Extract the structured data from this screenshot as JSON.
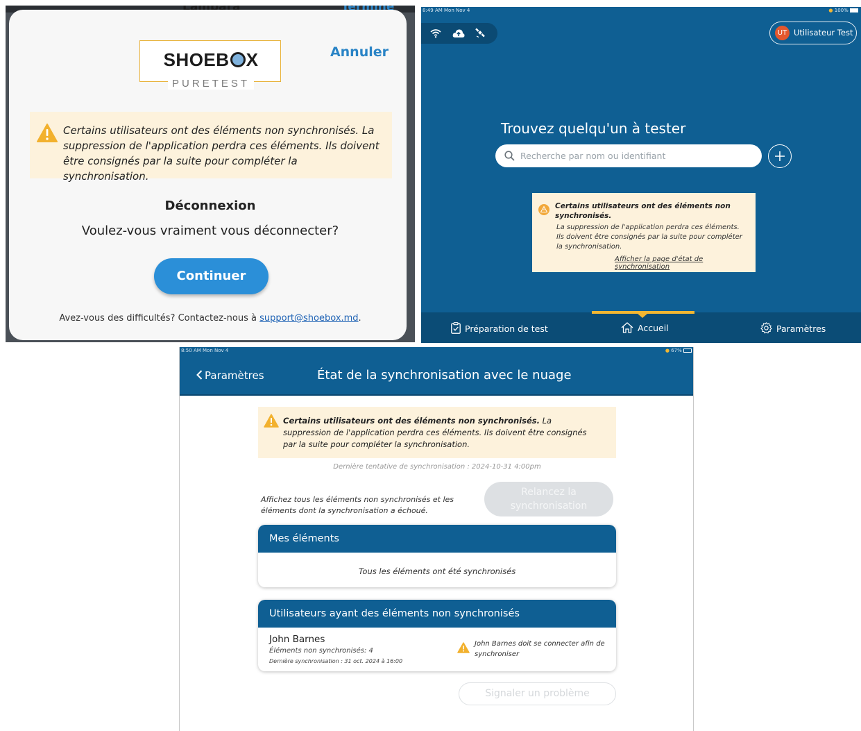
{
  "logout_dialog": {
    "background_labels": [
      "Lampara",
      "Terminé"
    ],
    "logo": {
      "brand": "SHOEBOX",
      "product": "PURETEST"
    },
    "cancel_label": "Annuler",
    "warning_text": "Certains utilisateurs ont des éléments non synchronisés. La suppression de l'application perdra ces éléments. Ils doivent être consignés par la suite pour compléter la synchronisation.",
    "title": "Déconnexion",
    "question": "Voulez-vous vraiment vous déconnecter?",
    "continue_label": "Continuer",
    "help_prefix": "Avez-vous des difficultés? Contactez-nous à ",
    "help_email": "support@shoebox.md",
    "help_suffix": "."
  },
  "home": {
    "status_time": "8:49 AM  Mon Nov 4",
    "status_battery": "100%",
    "status_icons": [
      "wifi-icon",
      "cloud-upload-icon",
      "satellite-icon"
    ],
    "user": {
      "initials": "UT",
      "name": "Utilisateur Test"
    },
    "find_title": "Trouvez quelqu'un à tester",
    "search_placeholder": "Recherche par nom ou identifiant",
    "warning_bold": "Certains utilisateurs ont des éléments non synchronisés.",
    "warning_text": "La suppression de l'application perdra ces éléments. Ils doivent être consignés par la suite pour compléter la synchronisation.",
    "warning_link": "Afficher la page d'état de synchronisation",
    "tabs": [
      {
        "label": "Préparation de test",
        "icon": "clipboard-check-icon"
      },
      {
        "label": "Accueil",
        "icon": "home-icon"
      },
      {
        "label": "Paramètres",
        "icon": "gear-icon"
      }
    ],
    "active_tab": "Accueil",
    "accent_color": "#f2b632",
    "primary_color": "#0f5f93"
  },
  "sync": {
    "status_time": "8:50 AM  Mon Nov 4",
    "status_battery": "67%",
    "back_label": "Paramètres",
    "title": "État de la synchronisation avec le nuage",
    "warning_bold": "Certains utilisateurs ont des éléments non synchronisés.",
    "warning_text": " La suppression de l'application perdra ces éléments. Ils doivent être consignés par la suite pour compléter la synchronisation.",
    "last_attempt": "Dernière tentative de synchronisation : 2024-10-31 4:00pm",
    "show_all": "Affichez tous les éléments non synchronisés et les éléments dont la synchronisation a échoué.",
    "relaunch_label": "Relancez la synchronisation",
    "my_items_title": "Mes éléments",
    "my_items_empty": "Tous les éléments ont été synchronisés",
    "users_title": "Utilisateurs ayant des éléments non synchronisés",
    "users": [
      {
        "name": "John Barnes",
        "unsynced": "Éléments non synchronisés: 4",
        "last_sync": "Dernière synchronisation : 31 oct. 2024 à 16:00",
        "message": "John Barnes doit se connecter afin de synchroniser"
      }
    ],
    "report_label": "Signaler un problème"
  }
}
